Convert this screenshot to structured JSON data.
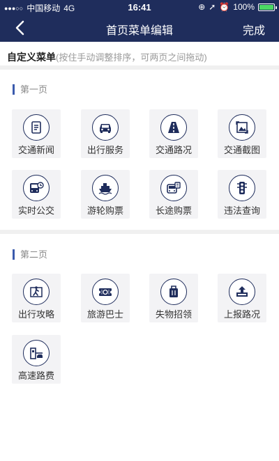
{
  "status_bar": {
    "carrier": "中国移动",
    "network": "4G",
    "time": "16:41",
    "battery": "100%",
    "battery_level": 1.0
  },
  "nav": {
    "title": "首页菜单编辑",
    "done_label": "完成"
  },
  "hint": {
    "title": "自定义菜单",
    "subtitle": "(按住手动调整排序，可两页之间拖动)"
  },
  "page1": {
    "title": "第一页",
    "items": [
      {
        "label": "交通新闻",
        "icon": "news-icon"
      },
      {
        "label": "出行服务",
        "icon": "car-icon"
      },
      {
        "label": "交通路况",
        "icon": "road-icon"
      },
      {
        "label": "交通截图",
        "icon": "image-icon"
      },
      {
        "label": "实时公交",
        "icon": "bus-clock-icon"
      },
      {
        "label": "游轮购票",
        "icon": "ship-icon"
      },
      {
        "label": "长途购票",
        "icon": "coach-ticket-icon"
      },
      {
        "label": "违法查询",
        "icon": "traffic-light-icon"
      }
    ]
  },
  "page2": {
    "title": "第二页",
    "items": [
      {
        "label": "出行攻略",
        "icon": "hiking-map-icon"
      },
      {
        "label": "旅游巴士",
        "icon": "ticket-icon"
      },
      {
        "label": "失物招领",
        "icon": "luggage-icon"
      },
      {
        "label": "上报路况",
        "icon": "upload-icon"
      },
      {
        "label": "高速路费",
        "icon": "toll-gate-icon"
      }
    ]
  },
  "colors": {
    "nav_bg": "#1f2d5c",
    "accent": "#3b5bad",
    "tile_bg": "#f3f3f5"
  }
}
